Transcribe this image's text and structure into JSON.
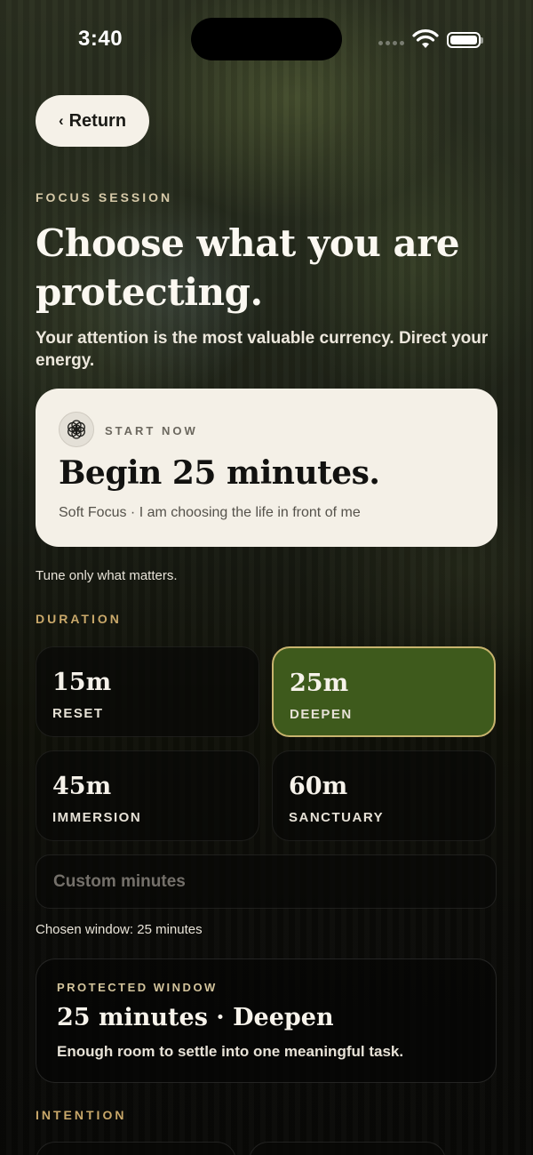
{
  "status_bar": {
    "time": "3:40"
  },
  "nav": {
    "return_label": "Return"
  },
  "header": {
    "kicker": "FOCUS SESSION",
    "title": "Choose what you are protecting.",
    "subtitle": "Your attention is the most valuable currency. Direct your energy."
  },
  "start_card": {
    "label": "START NOW",
    "title": "Begin 25 minutes.",
    "subtitle": "Soft Focus · I am choosing the life in front of me"
  },
  "tune_hint": "Tune only what matters.",
  "duration": {
    "label": "DURATION",
    "options": [
      {
        "value": "15m",
        "name": "RESET",
        "selected": false
      },
      {
        "value": "25m",
        "name": "DEEPEN",
        "selected": true
      },
      {
        "value": "45m",
        "name": "IMMERSION",
        "selected": false
      },
      {
        "value": "60m",
        "name": "SANCTUARY",
        "selected": false
      }
    ],
    "custom_placeholder": "Custom minutes",
    "custom_value": ""
  },
  "chosen_text": "Chosen window: 25 minutes",
  "protected_window": {
    "label": "PROTECTED WINDOW",
    "title": "25 minutes · Deepen",
    "description": "Enough room to settle into one meaningful task."
  },
  "intention": {
    "label": "INTENTION"
  },
  "colors": {
    "accent_gold": "#c9a86a",
    "selected_green": "#3e5a1c",
    "card_cream": "#f4f0e7"
  }
}
